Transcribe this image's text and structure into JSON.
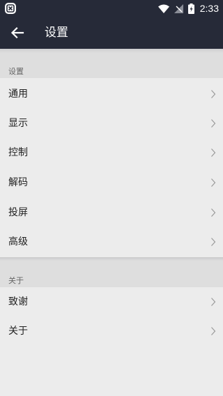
{
  "status_bar": {
    "time": "2:33",
    "icons": [
      "app-notification-icon",
      "wifi-icon",
      "no-signal-icon",
      "battery-charging-icon"
    ]
  },
  "app_bar": {
    "title": "设置",
    "back_icon": "arrow-left-icon"
  },
  "sections": [
    {
      "header": "设置",
      "items": [
        {
          "label": "通用"
        },
        {
          "label": "显示"
        },
        {
          "label": "控制"
        },
        {
          "label": "解码"
        },
        {
          "label": "投屏"
        },
        {
          "label": "高级"
        }
      ]
    },
    {
      "header": "关于",
      "items": [
        {
          "label": "致谢"
        },
        {
          "label": "关于"
        }
      ]
    }
  ],
  "colors": {
    "toolbar": "#262a38",
    "background": "#ececec",
    "section_header": "#dedede"
  }
}
